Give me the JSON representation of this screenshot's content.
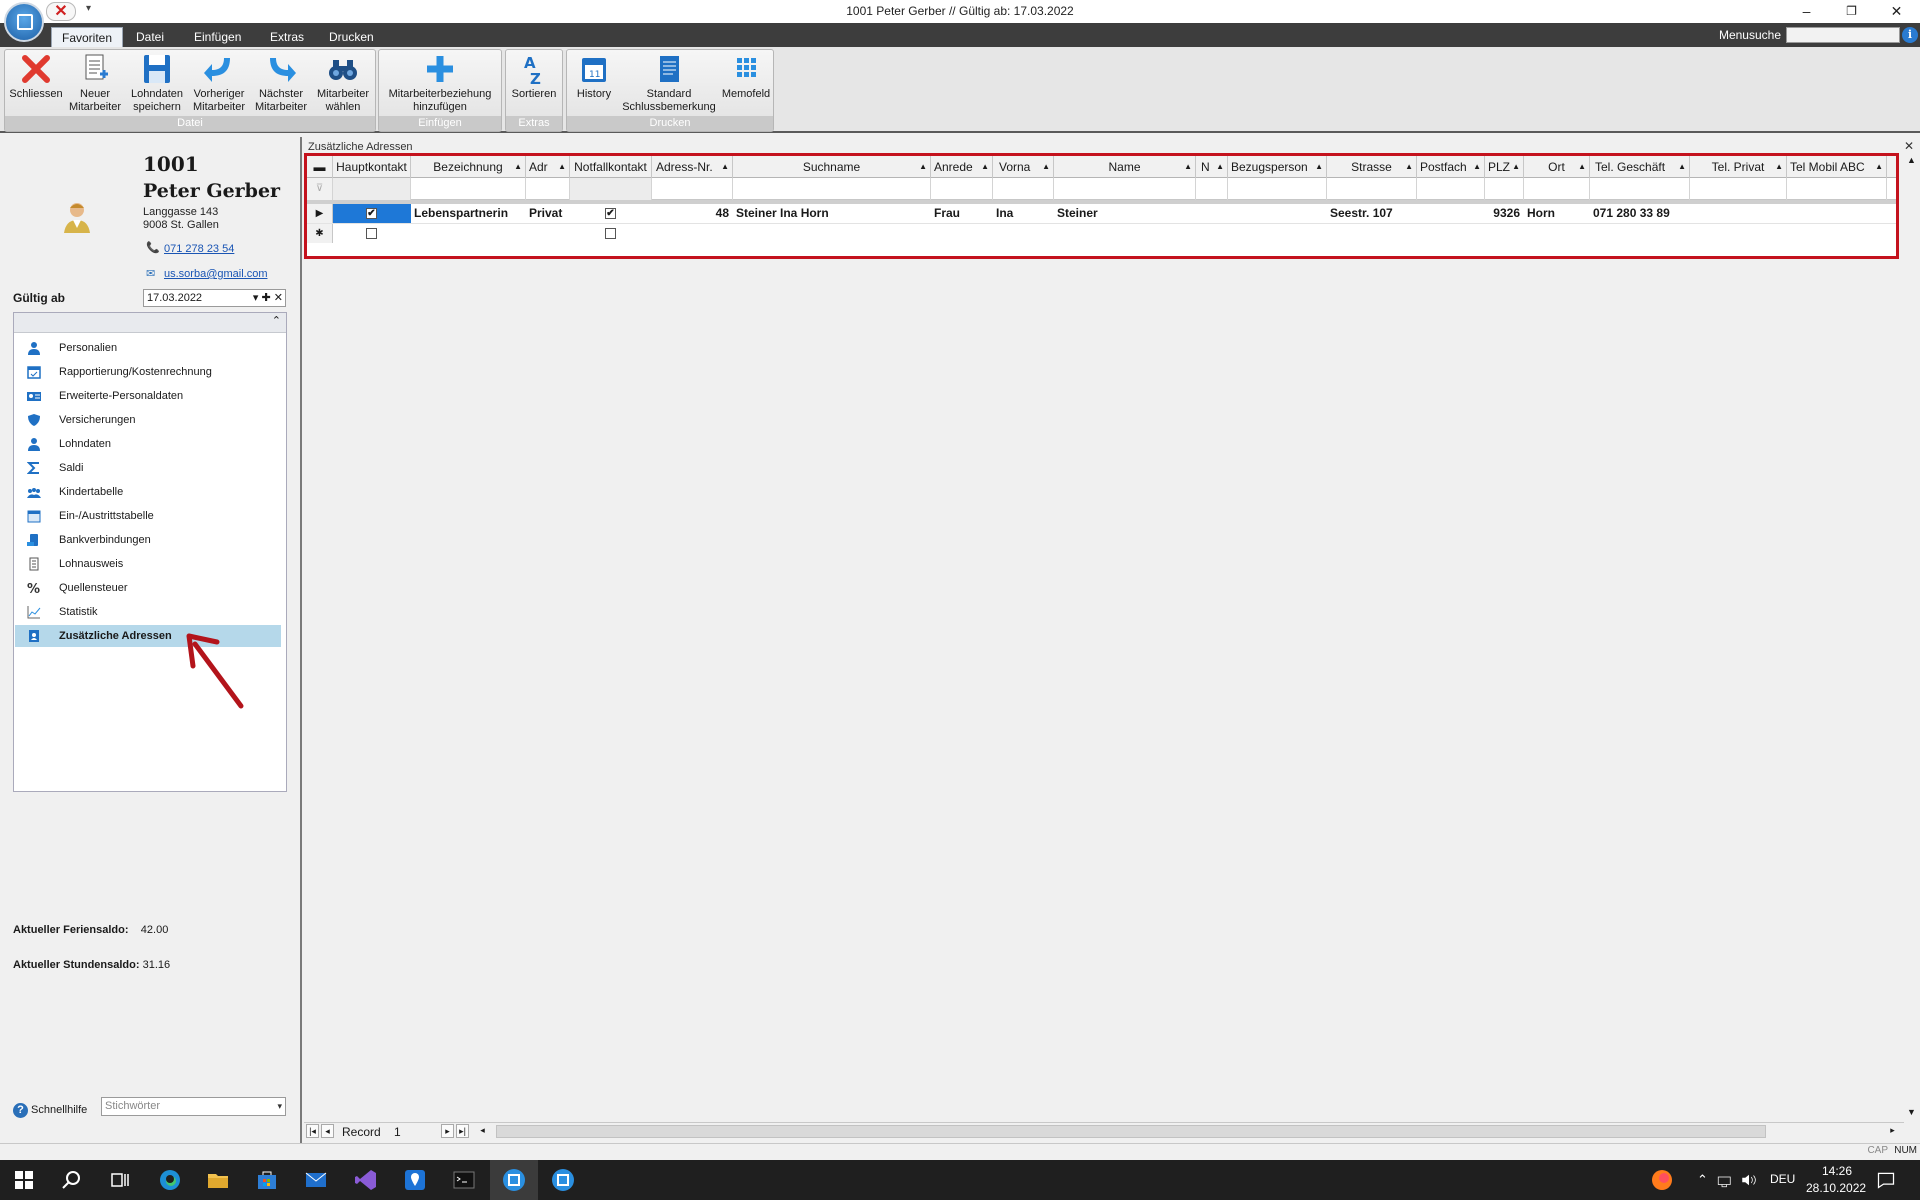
{
  "window": {
    "title": "1001 Peter Gerber // Gültig ab: 17.03.2022",
    "minimize": "–",
    "restore": "❐",
    "close": "✕"
  },
  "quick_access": {
    "close_glyph": "✕",
    "dropdown_glyph": "▾"
  },
  "tabs": [
    "Favoriten",
    "Datei",
    "Einfügen",
    "Extras",
    "Drucken"
  ],
  "menusuche": {
    "label": "Menusuche",
    "placeholder": "",
    "info_glyph": "i"
  },
  "ribbon": {
    "groups": [
      {
        "label": "Datei",
        "buttons": [
          "Schliessen",
          "Neuer\nMitarbeiter",
          "Lohndaten\nspeichern",
          "Vorheriger\nMitarbeiter",
          "Nächster\nMitarbeiter",
          "Mitarbeiter\nwählen"
        ]
      },
      {
        "label": "Einfügen",
        "buttons": [
          "Mitarbeiterbeziehung\nhinzufügen"
        ]
      },
      {
        "label": "Extras",
        "buttons": [
          "Sortieren"
        ]
      },
      {
        "label": "Drucken",
        "buttons": [
          "History",
          "Standard\nSchlussbemerkung",
          "Memofeld"
        ]
      }
    ],
    "button_labels": {
      "schliessen": "Schliessen",
      "neuer_1": "Neuer",
      "neuer_2": "Mitarbeiter",
      "lohn_1": "Lohndaten",
      "lohn_2": "speichern",
      "vorh_1": "Vorheriger",
      "vorh_2": "Mitarbeiter",
      "naechst_1": "Nächster",
      "naechst_2": "Mitarbeiter",
      "waehlen_1": "Mitarbeiter",
      "waehlen_2": "wählen",
      "bez_1": "Mitarbeiterbeziehung",
      "bez_2": "hinzufügen",
      "sortieren": "Sortieren",
      "history": "History",
      "std_1": "Standard",
      "std_2": "Schlussbemerkung",
      "memofeld": "Memofeld"
    },
    "group_labels": {
      "datei": "Datei",
      "einfuegen": "Einfügen",
      "extras": "Extras",
      "drucken": "Drucken"
    }
  },
  "employee": {
    "id": "1001",
    "name": "Peter Gerber",
    "street": "Langgasse 143",
    "city": "9008 St. Gallen",
    "phone": "071 278 23 54",
    "email": "us.sorba@gmail.com",
    "gueltig_label": "Gültig ab",
    "gueltig_value": "17.03.2022",
    "date_buttons": "▾  ✚  ✕"
  },
  "nav": {
    "collapse_glyph": "⌃",
    "items": [
      {
        "label": "Personalien",
        "icon": "person-icon"
      },
      {
        "label": "Rapportierung/Kostenrechnung",
        "icon": "calendar-icon"
      },
      {
        "label": "Erweiterte-Personaldaten",
        "icon": "id-card-icon"
      },
      {
        "label": "Versicherungen",
        "icon": "shield-icon"
      },
      {
        "label": "Lohndaten",
        "icon": "person-money-icon"
      },
      {
        "label": "Saldi",
        "icon": "sigma-icon"
      },
      {
        "label": "Kindertabelle",
        "icon": "children-icon"
      },
      {
        "label": "Ein-/Austrittstabelle",
        "icon": "calendar-in-out-icon"
      },
      {
        "label": "Bankverbindungen",
        "icon": "bank-icon"
      },
      {
        "label": "Lohnausweis",
        "icon": "document-icon"
      },
      {
        "label": "Quellensteuer",
        "icon": "percent-icon"
      },
      {
        "label": "Statistik",
        "icon": "chart-icon"
      },
      {
        "label": "Zusätzliche Adressen",
        "icon": "address-book-icon",
        "active": true
      }
    ]
  },
  "saldi": {
    "ferien_label": "Aktueller Feriensaldo:",
    "ferien_value": "42.00",
    "stunden_label": "Aktueller Stundensaldo:",
    "stunden_value": "31.16"
  },
  "help": {
    "label": "Schnellhilfe",
    "glyph": "?",
    "search_placeholder": "Stichwörter",
    "dropdown_glyph": "▾"
  },
  "grid": {
    "caption": "Zusätzliche Adressen",
    "close_glyph": "✕",
    "columns": [
      "Hauptkontakt",
      "Bezeichnung",
      "Adr",
      "Notfallkontakt",
      "Adress-Nr.",
      "Suchname",
      "Anrede",
      "Vorna",
      "Name",
      "N",
      "Bezugsperson",
      "Strasse",
      "Postfach",
      "PLZ",
      "Ort",
      "Tel. Geschäft",
      "Tel. Privat",
      "Tel Mobil",
      "ABC"
    ],
    "rows": [
      {
        "hauptkontakt": true,
        "bezeichnung": "Lebenspartnerin",
        "adr": "Privat",
        "notfallkontakt": true,
        "adress_nr": "48",
        "suchname": "Steiner Ina Horn",
        "anrede": "Frau",
        "vorname": "Ina",
        "name": "Steiner",
        "n": "",
        "bezugsperson": "",
        "strasse": "Seestr. 107",
        "postfach": "",
        "plz": "9326",
        "ort": "Horn",
        "tel_geschaeft": "071 280 33 89",
        "tel_privat": "",
        "tel_mobil": ""
      }
    ],
    "new_row_glyph": "✱",
    "current_row_glyph": "▶",
    "check_glyph": "✔",
    "sort_glyph": "▲",
    "filter_glyph": "⊽"
  },
  "record_nav": {
    "label": "Record",
    "value": "1",
    "first": "|◂",
    "prev": "◂",
    "next": "▸",
    "last": "▸|",
    "left": "◂",
    "right": "▸"
  },
  "status": {
    "cap": "CAP",
    "num": "NUM"
  },
  "taskbar": {
    "language": "DEU",
    "time": "14:26",
    "date": "28.10.2022",
    "tray_up": "⌃"
  },
  "colors": {
    "accent": "#2a7bd1",
    "highlight_border": "#c4121d",
    "active_nav": "#b5d8ea",
    "selected_cell": "#1e78d7"
  }
}
